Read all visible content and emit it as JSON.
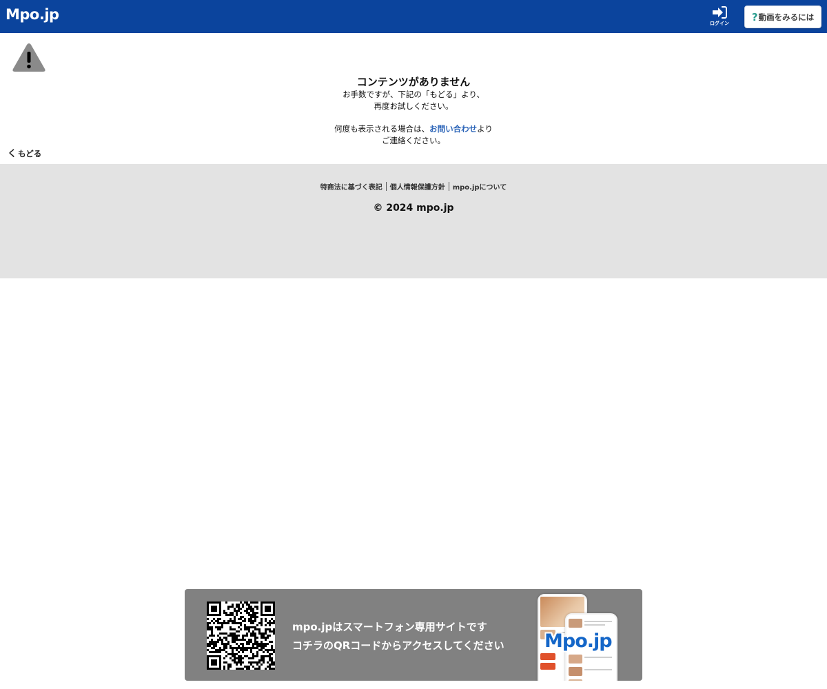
{
  "header": {
    "logo": "Mpo.jp",
    "login_label": "ログイン",
    "howto_button_label": "動画をみるには",
    "howto_icon_glyph": "?"
  },
  "error": {
    "title": "コンテンツがありません",
    "line1": "お手数ですが、下記の「もどる」より、",
    "line2": "再度お試しください。",
    "line3_before": "何度も表示される場合は、",
    "line3_link": "お問い合わせ",
    "line3_after": "より",
    "line4": "ご連絡ください。"
  },
  "back": {
    "label": "もどる",
    "chevron": "く"
  },
  "footer": {
    "links": [
      "特商法に基づく表記",
      "個人情報保護方針",
      "mpo.jpについて"
    ],
    "copyright": "© 2024 mpo.jp"
  },
  "banner": {
    "line1": "mpo.jpはスマートフォン専用サイトです",
    "line2": "コチラのQRコードからアクセスしてください",
    "phone_logo": "Mpo.jp"
  },
  "colors": {
    "header_bg": "#0b449d",
    "link": "#2b64b8",
    "footer_bg": "#e3e3e3",
    "banner_bg": "#818181",
    "warning_icon": "#8a8a8a"
  }
}
